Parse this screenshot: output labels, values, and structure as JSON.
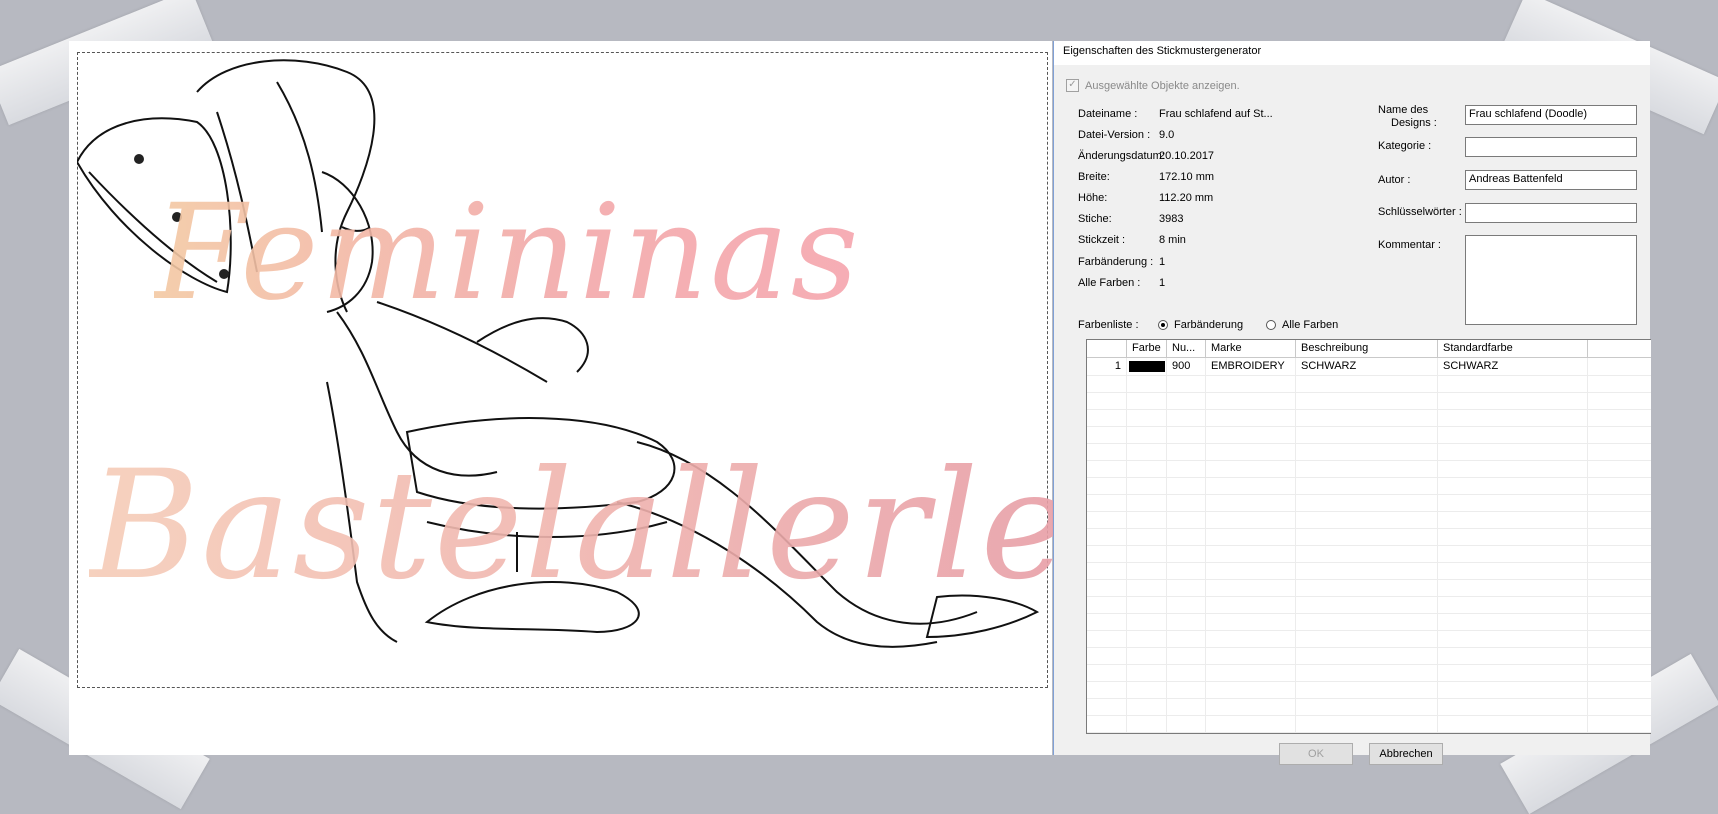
{
  "watermark": {
    "line1": "Femininas",
    "line2": "Bastelallerlei"
  },
  "dialog": {
    "title": "Eigenschaften des Stickmustergenerator",
    "show_selected_label": "Ausgewählte Objekte anzeigen.",
    "info": [
      {
        "label": "Dateiname :",
        "value": "Frau schlafend auf St..."
      },
      {
        "label": "Datei-Version :",
        "value": "9.0"
      },
      {
        "label": "Änderungsdatum:",
        "value": "20.10.2017"
      },
      {
        "label": "Breite:",
        "value": "172.10 mm"
      },
      {
        "label": "Höhe:",
        "value": "112.20 mm"
      },
      {
        "label": "Stiche:",
        "value": "3983"
      },
      {
        "label": "Stickzeit :",
        "value": "8 min"
      },
      {
        "label": "Farbänderung :",
        "value": "1"
      },
      {
        "label": "Alle Farben :",
        "value": "1"
      }
    ],
    "design_name_label_1": "Name des",
    "design_name_label_2": "Designs :",
    "design_name_value": "Frau schlafend (Doodle)",
    "category_label": "Kategorie :",
    "category_value": "",
    "author_label": "Autor :",
    "author_value": "Andreas Battenfeld",
    "keywords_label": "Schlüsselwörter :",
    "keywords_value": "",
    "comment_label": "Kommentar :",
    "colorlist_label": "Farbenliste :",
    "radio_color_change": "Farbänderung",
    "radio_all_colors": "Alle Farben",
    "radio_selected": "Farbänderung",
    "table": {
      "headers": [
        "",
        "Farbe",
        "Nu...",
        "Marke",
        "Beschreibung",
        "Standardfarbe",
        ""
      ],
      "rows": [
        {
          "index": "1",
          "color": "#000000",
          "number": "900",
          "brand": "EMBROIDERY",
          "description": "SCHWARZ",
          "standard": "SCHWARZ"
        }
      ]
    },
    "ok_label": "OK",
    "cancel_label": "Abbrechen"
  },
  "colors": {
    "background": "#b7b9c1",
    "accent_border": "#7fa0d6"
  }
}
